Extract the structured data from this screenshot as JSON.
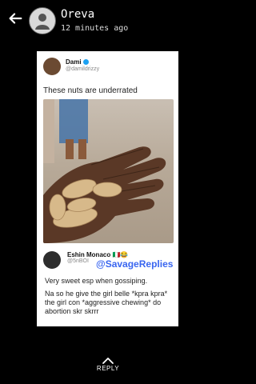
{
  "header": {
    "name": "Oreva",
    "time": "12 minutes ago"
  },
  "tweet": {
    "author": "Dami",
    "handle": "@damildrizzy",
    "text": "These nuts are underrated"
  },
  "reply": {
    "author": "Eshin Monaco",
    "flag_emoji": "🇮🇹😂",
    "handle": "@5nBOI",
    "watermark": "@SavageReplies",
    "line1": "Very sweet esp when gossiping.",
    "line2": "Na so he give the girl belle *kpra kpra* the girl con *aggressive chewing* do abortion skr skrrr"
  },
  "footer": {
    "reply_label": "REPLY"
  }
}
